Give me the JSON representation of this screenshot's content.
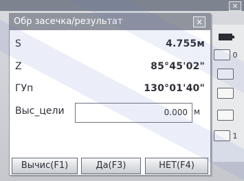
{
  "dialog": {
    "title": "Обр засечка/результат",
    "close_symbol": "×"
  },
  "rows": {
    "s": {
      "label": "S",
      "value": "4.755м"
    },
    "z": {
      "label": "Z",
      "value": "85°45'02\""
    },
    "gup": {
      "label": "ГУп",
      "value": "130°01'40\""
    },
    "target_height": {
      "label": "Выс_цели",
      "value": "0.000",
      "unit": "м"
    }
  },
  "softkeys": {
    "calc": "Вычис(F1)",
    "yes": "Да(F3)",
    "no": "НЕТ(F4)"
  },
  "status_strip": {
    "items": [
      {
        "name": "battery-icon",
        "text": ""
      },
      {
        "name": "level-icon",
        "text": "0"
      },
      {
        "name": "tilt-icon",
        "text": ""
      },
      {
        "name": "prism-icon",
        "text": ""
      },
      {
        "name": "keyboard-icon",
        "text": ""
      },
      {
        "name": "target-icon",
        "text": "1"
      }
    ]
  },
  "colors": {
    "title_bar": "#8f949d",
    "dialog_bg": "#ffffff",
    "text": "#2d3036"
  }
}
